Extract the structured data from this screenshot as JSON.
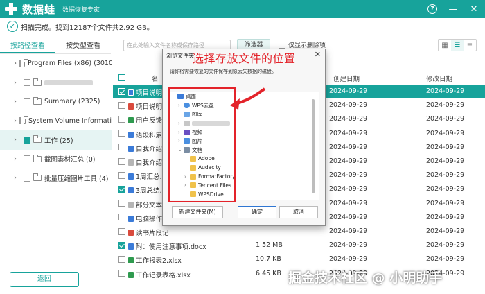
{
  "app": {
    "title": "数据蛙",
    "subtitle": "数据恢复专家"
  },
  "status": {
    "text": "扫描完成。找到12187个文件共2.92 GB。"
  },
  "toolbar": {
    "tab_path": "按路径查看",
    "tab_type": "按类型查看",
    "search_placeholder": "在此处输入文件名称或保存路径",
    "filter_label": "筛选器",
    "only_deleted_label": "仅显示删除项"
  },
  "tree": [
    {
      "label": "Program Files (x86) (3010",
      "blurred": false,
      "checked": false,
      "selected": false
    },
    {
      "label": "",
      "blurred": true,
      "checked": false,
      "selected": false
    },
    {
      "label": "Summary (2325)",
      "blurred": false,
      "checked": false,
      "selected": false
    },
    {
      "label": "System Volume Informati",
      "blurred": false,
      "checked": false,
      "selected": false
    },
    {
      "label": "工作 (25)",
      "blurred": false,
      "checked": true,
      "selected": true
    },
    {
      "label": "截图素材汇总 (0)",
      "blurred": false,
      "checked": false,
      "selected": false
    },
    {
      "label": "批量压缩图片工具 (4)",
      "blurred": false,
      "checked": false,
      "selected": false
    }
  ],
  "table": {
    "headers": {
      "name": "名",
      "created": "创建日期",
      "modified": "修改日期"
    },
    "rows": [
      {
        "name": "项目说明书",
        "icon": "doc",
        "size": "",
        "created": "2024-09-29",
        "modified": "2024-09-29",
        "highlight": true,
        "checked": true
      },
      {
        "name": "项目说明书",
        "icon": "pdf",
        "size": "",
        "created": "2024-09-29",
        "modified": "2024-09-29",
        "highlight": false,
        "checked": false
      },
      {
        "name": "用户反馈",
        "icon": "xls",
        "size": "",
        "created": "2024-09-29",
        "modified": "2024-09-29",
        "highlight": false,
        "checked": false
      },
      {
        "name": "语段积累.d",
        "icon": "doc",
        "size": "",
        "created": "2024-09-29",
        "modified": "2024-09-29",
        "highlight": false,
        "checked": false
      },
      {
        "name": "自我介绍.",
        "icon": "doc",
        "size": "",
        "created": "2024-09-29",
        "modified": "2024-09-29",
        "highlight": false,
        "checked": false
      },
      {
        "name": "自我介绍.t",
        "icon": "grey",
        "size": "",
        "created": "2024-09-29",
        "modified": "2024-09-29",
        "highlight": false,
        "checked": false
      },
      {
        "name": "1周汇总.do",
        "icon": "doc",
        "size": "",
        "created": "2024-09-29",
        "modified": "2024-09-29",
        "highlight": false,
        "checked": false
      },
      {
        "name": "3周总结.do",
        "icon": "doc",
        "size": "",
        "created": "2024-09-29",
        "modified": "2024-09-29",
        "highlight": false,
        "checked": true
      },
      {
        "name": "部分文本根",
        "icon": "grey",
        "size": "",
        "created": "2024-09-29",
        "modified": "2024-09-29",
        "highlight": false,
        "checked": false
      },
      {
        "name": "电脑操作技",
        "icon": "doc",
        "size": "",
        "created": "2024-09-29",
        "modified": "2024-09-29",
        "highlight": false,
        "checked": false
      },
      {
        "name": "读书片段记",
        "icon": "pdf",
        "size": "",
        "created": "2024-09-29",
        "modified": "2024-09-29",
        "highlight": false,
        "checked": false
      },
      {
        "name": "附：使用注意事项.docx",
        "icon": "doc",
        "size": "1.52 MB",
        "created": "2024-09-29",
        "modified": "2024-09-29",
        "highlight": false,
        "checked": true
      },
      {
        "name": "工作报表2.xlsx",
        "icon": "xls",
        "size": "10.7 KB",
        "created": "2024-09-29",
        "modified": "2024-09-29",
        "highlight": false,
        "checked": false
      },
      {
        "name": "工作记录表格.xlsx",
        "icon": "xls",
        "size": "6.45 KB",
        "created": "2024-09-29",
        "modified": "2024-09-29",
        "highlight": false,
        "checked": false
      }
    ]
  },
  "dialog": {
    "title": "浏览文件夹",
    "description": "请你将需要恢复的文件保存到原丢失数据的磁盘。",
    "nodes": [
      {
        "label": "桌面",
        "icon": "desk",
        "indent": 0,
        "expander": ""
      },
      {
        "label": "WPS云盘",
        "icon": "cloud",
        "indent": 1,
        "expander": "›"
      },
      {
        "label": "图库",
        "icon": "lib",
        "indent": 1,
        "expander": ""
      },
      {
        "label": "",
        "icon": "user",
        "indent": 1,
        "expander": "›"
      },
      {
        "label": "视频",
        "icon": "video",
        "indent": 1,
        "expander": "›"
      },
      {
        "label": "图片",
        "icon": "pic",
        "indent": 1,
        "expander": "›"
      },
      {
        "label": "文档",
        "icon": "doc",
        "indent": 1,
        "expander": "⌄"
      },
      {
        "label": "Adobe",
        "icon": "folder",
        "indent": 2,
        "expander": ""
      },
      {
        "label": "Audacity",
        "icon": "folder",
        "indent": 2,
        "expander": ""
      },
      {
        "label": "FormatFactory",
        "icon": "folder",
        "indent": 2,
        "expander": "›"
      },
      {
        "label": "Tencent Files",
        "icon": "folder",
        "indent": 2,
        "expander": "›"
      },
      {
        "label": "WPSDrive",
        "icon": "folder",
        "indent": 2,
        "expander": ""
      }
    ],
    "new_folder_label": "新建文件夹(M)",
    "ok_label": "确定",
    "cancel_label": "取消"
  },
  "annotation": {
    "text": "选择存放文件的位置"
  },
  "bottom": {
    "back_label": "返回",
    "watermark": "掘金技术社区 @ 小明助手"
  },
  "colors": {
    "accent": "#17a39b",
    "annotation_red": "#e3232a"
  }
}
